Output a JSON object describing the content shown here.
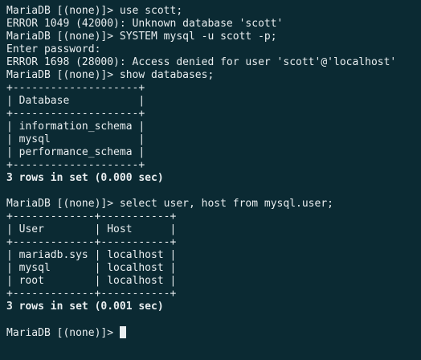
{
  "terminal": {
    "lines": [
      {
        "text": "MariaDB [(none)]> use scott;",
        "bold": false
      },
      {
        "text": "ERROR 1049 (42000): Unknown database 'scott'",
        "bold": false
      },
      {
        "text": "MariaDB [(none)]> SYSTEM mysql -u scott -p;",
        "bold": false
      },
      {
        "text": "Enter password:",
        "bold": false
      },
      {
        "text": "ERROR 1698 (28000): Access denied for user 'scott'@'localhost'",
        "bold": false
      },
      {
        "text": "MariaDB [(none)]> show databases;",
        "bold": false
      },
      {
        "text": "+--------------------+",
        "bold": false
      },
      {
        "text": "| Database           |",
        "bold": false
      },
      {
        "text": "+--------------------+",
        "bold": false
      },
      {
        "text": "| information_schema |",
        "bold": false
      },
      {
        "text": "| mysql              |",
        "bold": false
      },
      {
        "text": "| performance_schema |",
        "bold": false
      },
      {
        "text": "+--------------------+",
        "bold": false
      },
      {
        "text": "3 rows in set (0.000 sec)",
        "bold": true
      },
      {
        "text": "",
        "bold": false
      },
      {
        "text": "MariaDB [(none)]> select user, host from mysql.user;",
        "bold": false
      },
      {
        "text": "+-------------+-----------+",
        "bold": false
      },
      {
        "text": "| User        | Host      |",
        "bold": false
      },
      {
        "text": "+-------------+-----------+",
        "bold": false
      },
      {
        "text": "| mariadb.sys | localhost |",
        "bold": false
      },
      {
        "text": "| mysql       | localhost |",
        "bold": false
      },
      {
        "text": "| root        | localhost |",
        "bold": false
      },
      {
        "text": "+-------------+-----------+",
        "bold": false
      },
      {
        "text": "3 rows in set (0.001 sec)",
        "bold": true
      },
      {
        "text": "",
        "bold": false
      }
    ],
    "prompt": "MariaDB [(none)]> "
  }
}
